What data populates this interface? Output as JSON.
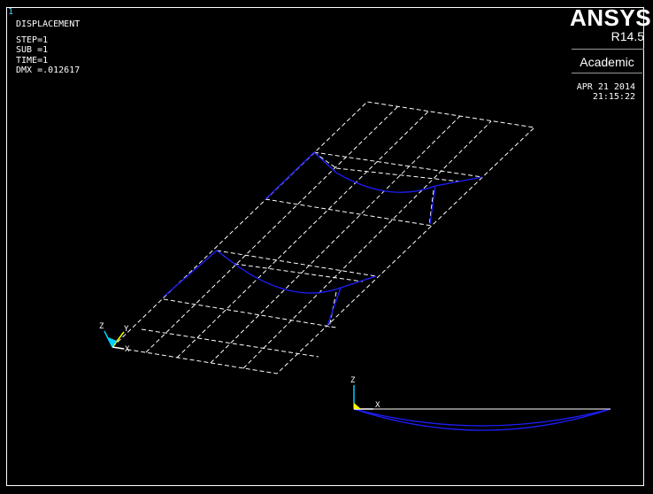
{
  "window": {
    "number": "1"
  },
  "result_info": {
    "title": "DISPLACEMENT",
    "step": "STEP=1",
    "sub": "SUB =1",
    "time": "TIME=1",
    "dmx": "DMX =.012617"
  },
  "branding": {
    "product": "ANSYS",
    "release": "R14.5",
    "edition": "Academic"
  },
  "timestamp": {
    "date": "APR 21 2014",
    "time": "21:15:22"
  },
  "triads": {
    "main": {
      "z": "Z",
      "y": "Y",
      "x": "X"
    },
    "side": {
      "z": "Z",
      "x": "X"
    }
  },
  "colors": {
    "background": "#000000",
    "undeformed_mesh": "#ffffff",
    "deformed_shape": "#1e1eff",
    "window_number": "#4fd0ff",
    "triad_z": "#00d0ff",
    "triad_y": "#ffff00",
    "triad_x": "#ffffff"
  }
}
